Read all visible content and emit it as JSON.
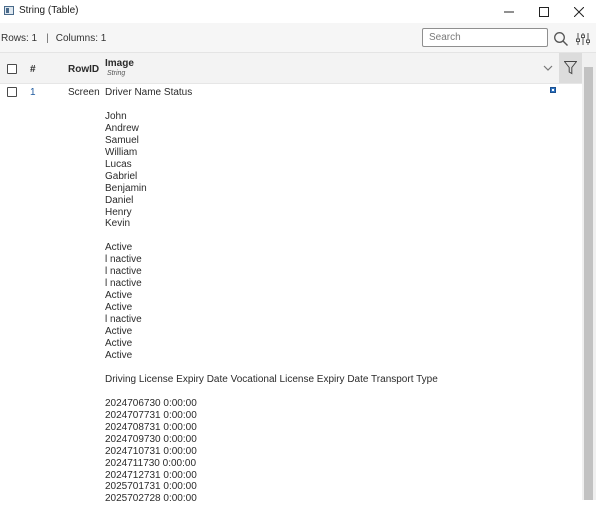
{
  "window": {
    "title": "String (Table)",
    "controls": [
      "minimize",
      "maximize",
      "close"
    ]
  },
  "toolbar": {
    "rows_label": "Rows: 1",
    "separator": "|",
    "columns_label": "Columns: 1",
    "search_placeholder": "Search",
    "search_value": ""
  },
  "table": {
    "columns": {
      "index": "#",
      "rowid": "RowID",
      "image": "Image",
      "image_type": "String"
    },
    "rows": [
      {
        "number": "1",
        "rowid": "Screen",
        "image_text": "Driver Name Status\n\nJohn\nAndrew\nSamuel\nWilliam\nLucas\nGabriel\nBenjamin\nDaniel\nHenry\nKevin\n\nActive\nl nactive\nl nactive\nl nactive\nActive\nActive\nl nactive\nActive\nActive\nActive\n\nDriving License Expiry Date Vocational License Expiry Date Transport Type\n\n2024706730 0:00:00\n2024707731 0:00:00\n2024708731 0:00:00\n2024709730 0:00:00\n2024710731 0:00:00\n2024711730 0:00:00\n2024712731 0:00:00\n2025701731 0:00:00\n2025702728 0:00:00"
      }
    ]
  },
  "icons": {
    "search": "search-icon",
    "settings": "sliders-icon",
    "filter": "filter-icon",
    "column_menu": "chevron-down-icon",
    "cell_expand": "expand-icon"
  },
  "colors": {
    "accent_link": "#1e5a9e",
    "header_bg": "#f3f3f3",
    "filter_bg": "#dcdcdc",
    "expand_icon": "#2f76c6"
  }
}
